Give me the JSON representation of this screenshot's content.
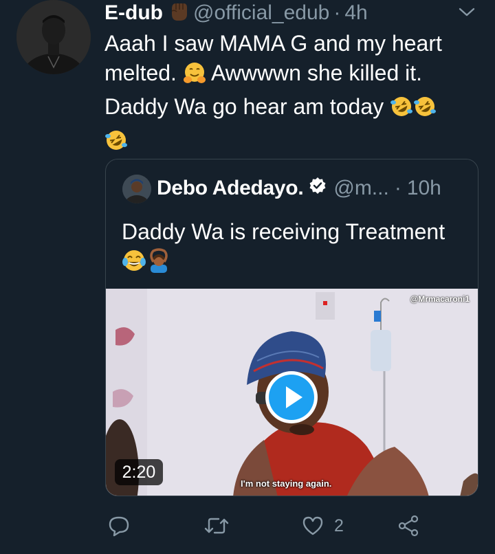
{
  "tweet": {
    "author_name": "E-dub",
    "author_handle": "@official_edub",
    "separator": "·",
    "time": "4h",
    "text_line1": "Aaah I saw MAMA G and my heart",
    "text_line2a": "melted.",
    "text_line2b": "Awwwwn she killed it.",
    "text_line3": "Daddy Wa go hear am today",
    "icons": [
      "raised-fist-icon",
      "hugging-face-icon",
      "rolling-on-floor-laughing-icon",
      "caret-down-icon"
    ]
  },
  "quoted_tweet": {
    "author_name": "Debo Adedayo.",
    "author_handle": "@m...",
    "separator": "·",
    "time": "10h",
    "text": "Daddy Wa is receiving Treatment",
    "icons": [
      "verified-badge-icon",
      "face-with-tears-of-joy-icon",
      "person-gesturing-ok-icon"
    ],
    "video": {
      "watermark": "@Mrmacaroni1",
      "duration": "2:20",
      "subtitle": "I'm not staying again."
    }
  },
  "actions": {
    "reply_count": "",
    "retweet_count": "",
    "like_count": "2",
    "icons": [
      "reply-icon",
      "retweet-icon",
      "like-icon",
      "share-icon"
    ]
  },
  "colors": {
    "background": "#15202b",
    "secondary_text": "#8899a6",
    "border": "#38444d",
    "accent": "#1da1f2"
  }
}
